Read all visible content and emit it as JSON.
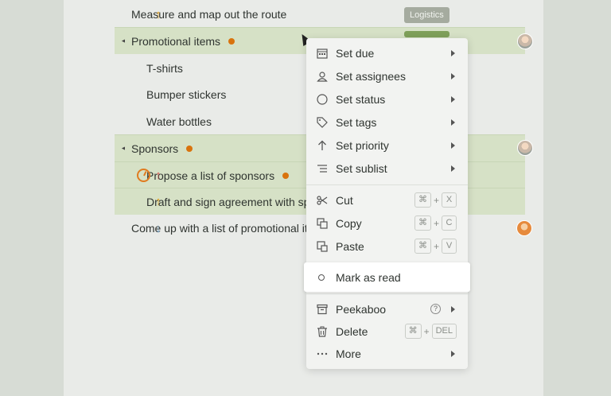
{
  "tasks": [
    {
      "title": "Measure and map out the route",
      "tag": "Logistics"
    },
    {
      "title": "Promotional items"
    },
    {
      "title": "T-shirts"
    },
    {
      "title": "Bumper stickers"
    },
    {
      "title": "Water bottles"
    },
    {
      "title": "Sponsors"
    },
    {
      "title": "Propose a list of sponsors"
    },
    {
      "title": "Draft and sign agreement with sp"
    },
    {
      "title": "Come up with a list of promotional ite"
    }
  ],
  "icons": {
    "up_arrow": "↑",
    "down_arrow": "↓",
    "expand": "▲"
  },
  "menu": {
    "set_due": "Set due",
    "set_assignees": "Set assignees",
    "set_status": "Set status",
    "set_tags": "Set tags",
    "set_priority": "Set priority",
    "set_sublist": "Set sublist",
    "cut": "Cut",
    "copy": "Copy",
    "paste": "Paste",
    "mark_as_read": "Mark as read",
    "peekaboo": "Peekaboo",
    "delete": "Delete",
    "more": "More",
    "cmd": "⌘",
    "plus": "+",
    "x": "X",
    "c": "C",
    "v": "V",
    "del": "DEL",
    "help": "?"
  },
  "colors": {
    "highlight": "#d6e1c6",
    "dot": "#d9730d",
    "tag": "#a5ab9f"
  }
}
